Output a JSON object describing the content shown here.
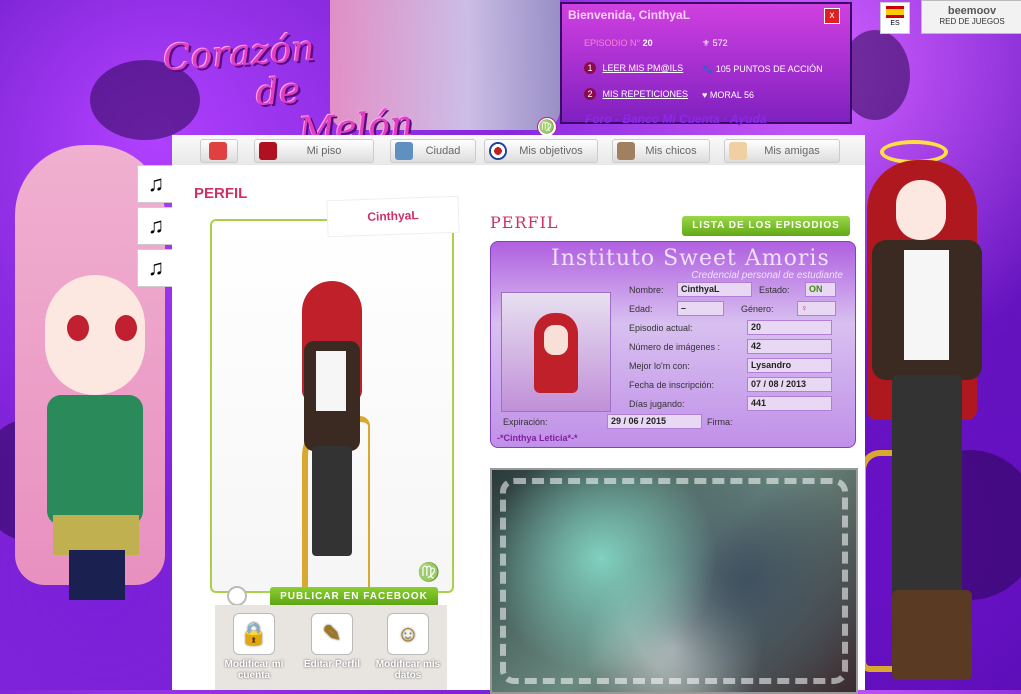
{
  "header": {
    "logo_line1": "Corazón",
    "logo_line2": "de",
    "logo_line3": "Melón",
    "zodiac_symbol": "♍",
    "links": "Foro - Banco Mi Cuenta  ·  Ayuda",
    "lang": "ES",
    "brand": "beemoov",
    "brand_sub": "RED DE JUEGOS"
  },
  "panel": {
    "welcome": "Bienvenida, CinthyaL",
    "close": "x",
    "episode_label": "EPISODIO N°",
    "episode_value": "20",
    "stat1_value": "572",
    "mails_badge": "1",
    "mails_label": "LEER MIS PM@ILS",
    "action_points": "105 PUNTOS DE ACCIÓN",
    "reps_badge": "2",
    "reps_label": "MIS REPETICIONES",
    "moral": "MORAL 56"
  },
  "nav": {
    "home": "",
    "mi_piso": "Mi piso",
    "ciudad": "Ciudad",
    "mis_objetivos": "Mis objetivos",
    "mis_chicos": "Mis chicos",
    "mis_amigas": "Mis amigas"
  },
  "music": [
    "♫",
    "♫",
    "♫"
  ],
  "profile": {
    "section_title": "PERFIL",
    "name_tab": "CinthyaL",
    "publish_button": "PUBLICAR EN FACEBOOK",
    "zodiac": "♍",
    "actions": [
      {
        "label": "Modificar mi cuenta",
        "icon": "🔒"
      },
      {
        "label": "Editar Perfil",
        "icon": "✎"
      },
      {
        "label": "Modificar mis datos",
        "icon": "☺"
      }
    ]
  },
  "card": {
    "heading": "PERFIL",
    "episodes_button": "LISTA DE LOS EPISODIOS",
    "title": "Instituto Sweet Amoris",
    "subtitle": "Credencial personal de estudiante",
    "fields": {
      "nombre_label": "Nombre:",
      "nombre_value": "CinthyaL",
      "estado_label": "Estado:",
      "estado_value": "ON",
      "edad_label": "Edad:",
      "edad_value": "–",
      "genero_label": "Género:",
      "genero_value": "♀",
      "episodio_label": "Episodio actual:",
      "episodio_value": "20",
      "imagenes_label": "Número de imágenes :",
      "imagenes_value": "42",
      "mejor_label": "Mejor lo'm con:",
      "mejor_value": "Lysandro",
      "inscripcion_label": "Fecha de inscripción:",
      "inscripcion_value": "07 / 08 / 2013",
      "dias_label": "Días jugando:",
      "dias_value": "441",
      "expiracion_label": "Expiración:",
      "expiracion_value": "29 / 06 / 2015",
      "firma_label": "Firma:"
    },
    "signature": "-*Cinthya Leticia*-*"
  }
}
